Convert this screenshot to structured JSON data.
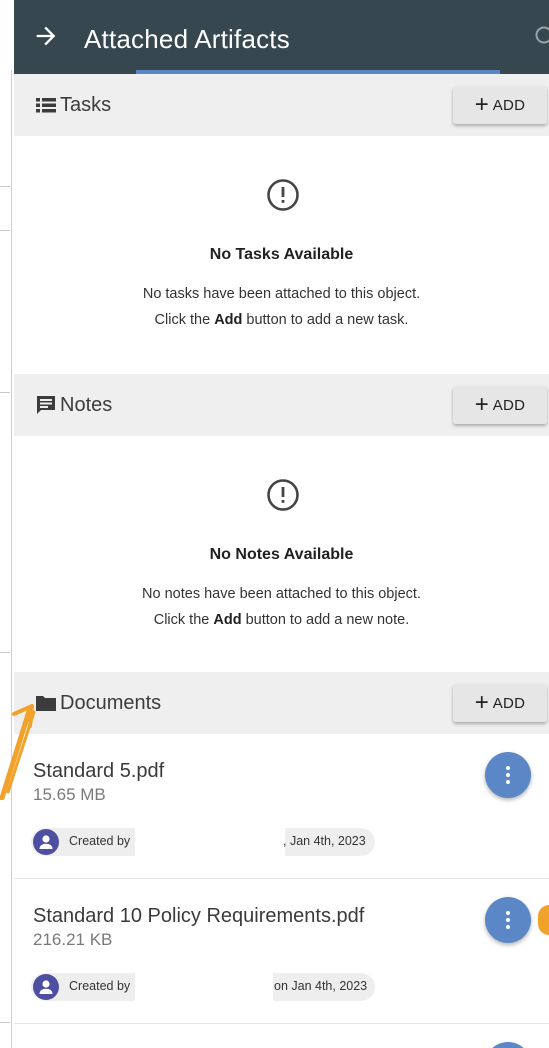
{
  "header": {
    "title": "Attached Artifacts",
    "back_icon": "arrow-right-icon"
  },
  "tasks": {
    "label": "Tasks",
    "add_label": "ADD",
    "empty_title": "No Tasks Available",
    "empty_line1": "No tasks have been attached to this object.",
    "empty_line2_pre": "Click the ",
    "empty_line2_bold": "Add",
    "empty_line2_post": " button to add a new task."
  },
  "notes": {
    "label": "Notes",
    "add_label": "ADD",
    "empty_title": "No Notes Available",
    "empty_line1": "No notes have been attached to this object.",
    "empty_line2_pre": "Click the ",
    "empty_line2_bold": "Add",
    "empty_line2_post": " button to add a new note."
  },
  "documents": {
    "label": "Documents",
    "add_label": "ADD",
    "items": [
      {
        "name": "Standard 5.pdf",
        "size": "15.65 MB",
        "created_prefix": "Created by",
        "created_suffix": ", Jan 4th, 2023"
      },
      {
        "name": "Standard 10 Policy Requirements.pdf",
        "size": "216.21 KB",
        "created_prefix": "Created by",
        "created_suffix": "on Jan 4th, 2023"
      }
    ]
  },
  "colors": {
    "header_bg": "#37474f",
    "accent": "#5b87c7",
    "section_bg": "#efefef",
    "avatar": "#4e4fa0",
    "annotation": "#f0a22a"
  }
}
